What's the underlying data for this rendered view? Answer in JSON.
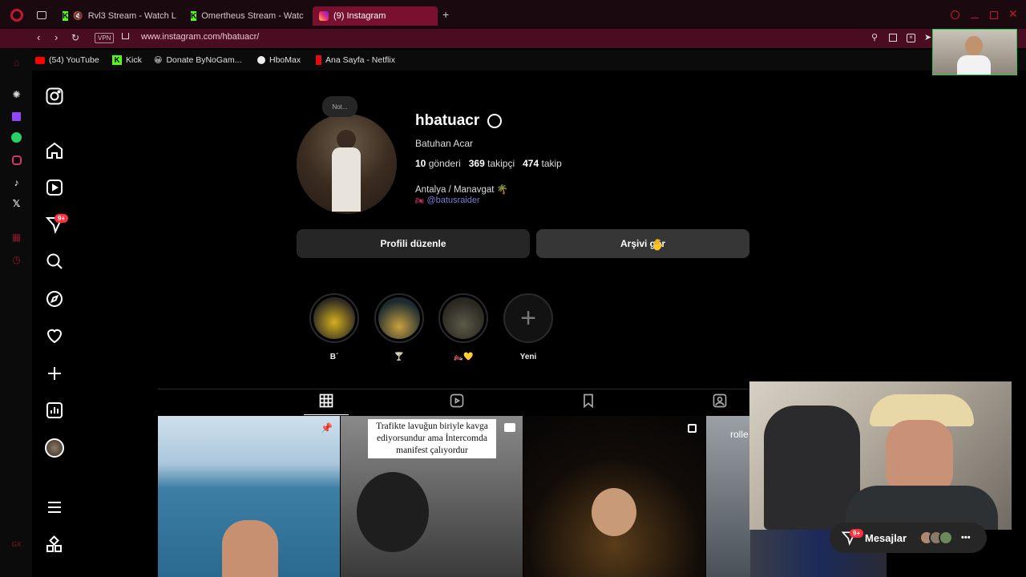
{
  "browser": {
    "tabs": [
      {
        "label": "Rvl3 Stream - Watch L"
      },
      {
        "label": "Omertheus Stream - Watc"
      },
      {
        "label": "(9) Instagram"
      }
    ],
    "address": "www.instagram.com/hbatuacr/",
    "vpn_label": "VPN",
    "bookmarks": [
      {
        "label": "(54) YouTube"
      },
      {
        "label": "Kick"
      },
      {
        "label": "Donate ByNoGam..."
      },
      {
        "label": "HboMax"
      },
      {
        "label": "Ana Sayfa - Netflix"
      }
    ],
    "sidebar_badge": "9+"
  },
  "profile": {
    "note": "Not...",
    "username": "hbatuacr",
    "full_name": "Batuhan Acar",
    "stats": {
      "posts_count": "10",
      "posts_label": "gönderi",
      "followers_count": "369",
      "followers_label": "takipçi",
      "following_count": "474",
      "following_label": "takip"
    },
    "bio": "Antalya / Manavgat 🌴",
    "bio_link": "@batusraider",
    "edit_button": "Profili düzenle",
    "archive_button": "Arşivi gör"
  },
  "highlights": [
    {
      "label": "B´"
    },
    {
      "label": "🍸"
    },
    {
      "label": "🏍️💛"
    },
    {
      "label": "Yeni"
    }
  ],
  "posts": [
    {
      "caption": ""
    },
    {
      "caption": "Trafikte lavuğun biriyle kavga ediyorsundur ama İntercomda manifest çalıyordur"
    },
    {
      "caption": ""
    },
    {
      "caption": "rolle"
    }
  ],
  "messages": {
    "label": "Mesajlar",
    "badge": "9+"
  }
}
